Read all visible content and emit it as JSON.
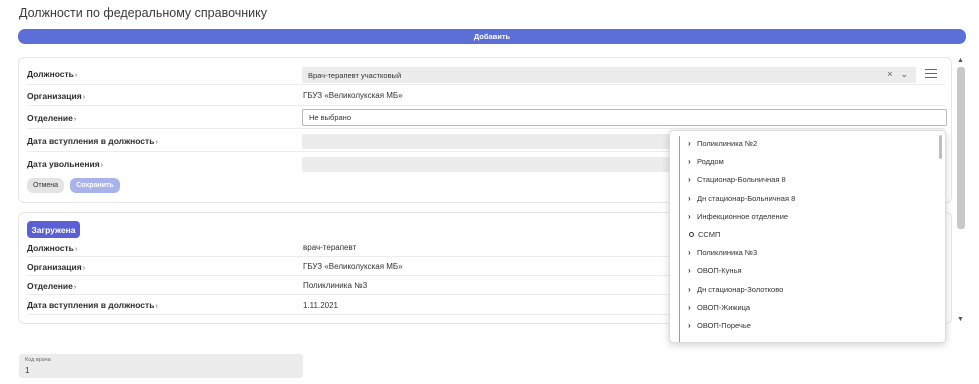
{
  "page_title": "Должности по федеральному справочнику",
  "add_button": "Добавить",
  "form": {
    "position_label": "Должность",
    "position_value": "Врач-терапевт участковый",
    "clear_icon": "×",
    "chevron_icon": "⌄",
    "organization_label": "Организация",
    "organization_value": "ГБУЗ «Великолукская МБ»",
    "department_label": "Отделение",
    "department_value": "Не выбрано",
    "start_label": "Дата вступления в должность",
    "end_label": "Дата увольнения",
    "cancel": "Отмена",
    "save": "Сохранить"
  },
  "record": {
    "badge": "Загружена",
    "position_label": "Должность",
    "position_value": "врач-терапевт",
    "organization_label": "Организация",
    "organization_value": "ГБУЗ «Великолукская МБ»",
    "department_label": "Отделение",
    "department_value": "Поликлиника №3",
    "start_label": "Дата вступления в должность",
    "start_value": "1.11.2021"
  },
  "dropdown": {
    "items": [
      {
        "label": "Поликлиника №2",
        "icon": "chevron-right"
      },
      {
        "label": "Роддом",
        "icon": "chevron-right"
      },
      {
        "label": "Стационар-Больничная 8",
        "icon": "chevron-right"
      },
      {
        "label": "Дн стационар-Больничная 8",
        "icon": "chevron-right"
      },
      {
        "label": "Инфекционное отделение",
        "icon": "chevron-right"
      },
      {
        "label": "ССМП",
        "icon": "circle"
      },
      {
        "label": "Поликлиника №3",
        "icon": "chevron-right"
      },
      {
        "label": "ОВОП-Кунья",
        "icon": "chevron-right"
      },
      {
        "label": "Дн стационар-Золотково",
        "icon": "chevron-right"
      },
      {
        "label": "ОВОП-Жижица",
        "icon": "chevron-right"
      },
      {
        "label": "ОВОП-Поречье",
        "icon": "chevron-right"
      }
    ]
  },
  "doctor_code": {
    "caption": "Код врача",
    "value": "1"
  },
  "colors": {
    "accent": "#5b6fd6",
    "badge": "#5a5fd4",
    "save_disabled": "#a7b3ea"
  }
}
